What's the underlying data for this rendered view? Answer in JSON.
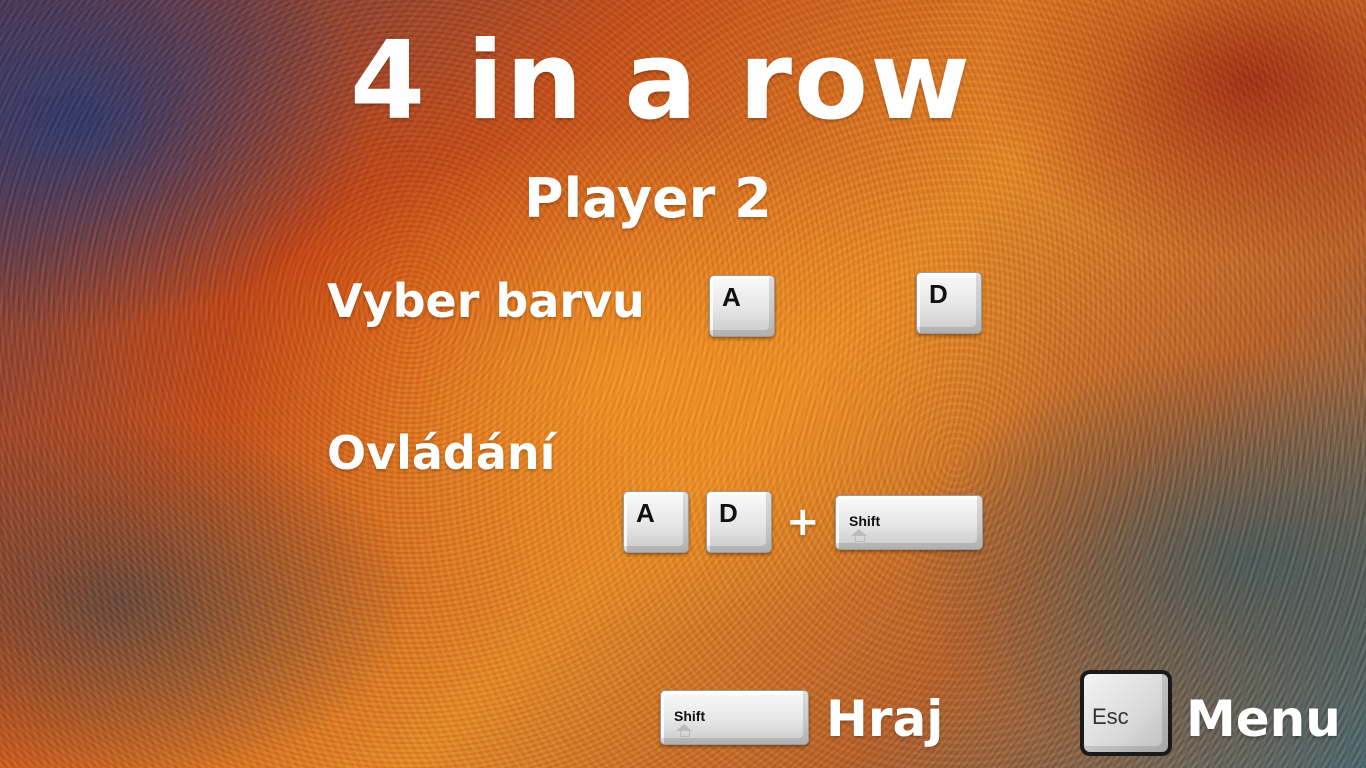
{
  "title": "4 in a row",
  "player": "Player 2",
  "color_section": {
    "label": "Vyber barvu",
    "key_left": "A",
    "key_right": "D"
  },
  "controls_section": {
    "label": "Ovládání",
    "key_left": "A",
    "key_right": "D",
    "plus": "+",
    "modifier_key": "Shift"
  },
  "footer": {
    "play_key": "Shift",
    "play_label": "Hraj",
    "menu_key": "Esc",
    "menu_label": "Menu"
  },
  "colors": {
    "text": "#ffffff",
    "key_face": "#e6e6e6",
    "esc_border": "#1a1a1a"
  }
}
